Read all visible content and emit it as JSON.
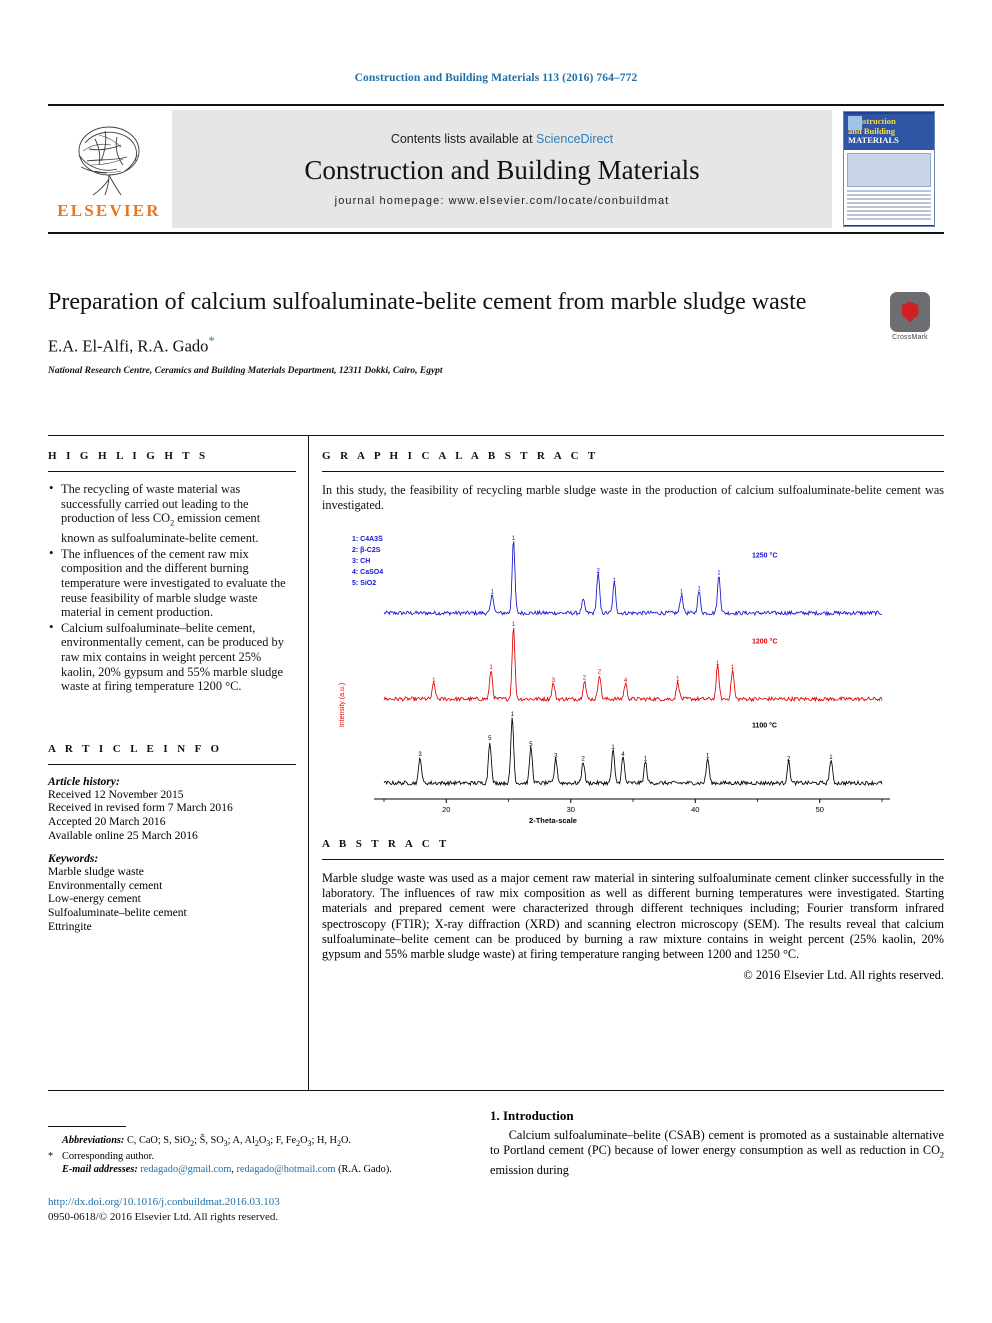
{
  "running_head": "Construction and Building Materials 113 (2016) 764–772",
  "masthead": {
    "contents_prefix": "Contents lists available at ",
    "sciencedirect": "ScienceDirect",
    "journal_title": "Construction and Building Materials",
    "homepage": "journal homepage: www.elsevier.com/locate/conbuildmat",
    "publisher": "ELSEVIER",
    "cover": {
      "line1": "Construction",
      "line2": "and Building",
      "line3": "MATERIALS"
    }
  },
  "article": {
    "title": "Preparation of calcium sulfoaluminate-belite cement from marble sludge waste",
    "authors": "E.A. El-Alfi, R.A. Gado",
    "corresponding_marker": "*",
    "affiliation": "National Research Centre, Ceramics and Building Materials Department, 12311 Dokki, Cairo, Egypt",
    "crossmark_label": "CrossMark"
  },
  "highlights": {
    "heading": "H I G H L I G H T S",
    "items": [
      "The recycling of waste material was successfully carried out leading to the production of less CO2 emission cement known as sulfoaluminate-belite cement.",
      "The influences of the cement raw mix composition and the different burning temperature were investigated to evaluate the reuse feasibility of marble sludge waste material in cement production.",
      "Calcium sulfoaluminate–belite cement, environmentally cement, can be produced by raw mix contains in weight percent 25% kaolin, 20% gypsum and 55% marble sludge waste at firing temperature 1200 °C."
    ]
  },
  "graphical_abstract": {
    "heading": "G R A P H I C A L   A B S T R A C T",
    "text": "In this study, the feasibility of recycling marble sludge waste in the production of calcium sulfoaluminate-belite cement was investigated."
  },
  "chart_data": {
    "type": "line",
    "title": "",
    "xlabel": "2-Theta-scale",
    "ylabel": "Intensity (a.u.)",
    "xlim": [
      15,
      55
    ],
    "xticks": [
      20,
      30,
      40,
      50
    ],
    "grid": false,
    "legend_position": "top-left",
    "legend": [
      "1: C4A3S̅",
      "2: β-C2S",
      "3: CH",
      "4: CaSO4",
      "5: SiO2"
    ],
    "series": [
      {
        "name": "1250 °C",
        "color": "#1414d2",
        "annotation": "1250 °C",
        "peaks": [
          {
            "x": 23.7,
            "h": 0.26,
            "label": "1"
          },
          {
            "x": 25.4,
            "h": 1.0,
            "label": "1"
          },
          {
            "x": 31.0,
            "h": 0.18,
            "label": ""
          },
          {
            "x": 32.2,
            "h": 0.55,
            "label": "2"
          },
          {
            "x": 33.5,
            "h": 0.42,
            "label": "1"
          },
          {
            "x": 38.9,
            "h": 0.26,
            "label": "1"
          },
          {
            "x": 40.3,
            "h": 0.3,
            "label": "1"
          },
          {
            "x": 41.9,
            "h": 0.52,
            "label": "1"
          }
        ]
      },
      {
        "name": "1200 °C",
        "color": "#e00000",
        "annotation": "1200 °C",
        "peaks": [
          {
            "x": 19.0,
            "h": 0.22,
            "label": "1"
          },
          {
            "x": 23.6,
            "h": 0.4,
            "label": "1"
          },
          {
            "x": 25.4,
            "h": 1.0,
            "label": "1"
          },
          {
            "x": 28.6,
            "h": 0.22,
            "label": "3"
          },
          {
            "x": 31.1,
            "h": 0.26,
            "label": "2"
          },
          {
            "x": 32.3,
            "h": 0.34,
            "label": "2"
          },
          {
            "x": 34.4,
            "h": 0.22,
            "label": "4"
          },
          {
            "x": 38.6,
            "h": 0.24,
            "label": "1"
          },
          {
            "x": 41.8,
            "h": 0.46,
            "label": "1"
          },
          {
            "x": 43.0,
            "h": 0.4,
            "label": "1"
          }
        ]
      },
      {
        "name": "1100 °C",
        "color": "#000000",
        "annotation": "1100 °C",
        "peaks": [
          {
            "x": 17.9,
            "h": 0.36,
            "label": "3"
          },
          {
            "x": 23.5,
            "h": 0.58,
            "label": "5"
          },
          {
            "x": 25.3,
            "h": 0.92,
            "label": "1"
          },
          {
            "x": 26.8,
            "h": 0.5,
            "label": "5"
          },
          {
            "x": 28.8,
            "h": 0.34,
            "label": "3"
          },
          {
            "x": 31.0,
            "h": 0.3,
            "label": "2"
          },
          {
            "x": 33.4,
            "h": 0.46,
            "label": "1"
          },
          {
            "x": 34.2,
            "h": 0.36,
            "label": "4"
          },
          {
            "x": 36.0,
            "h": 0.3,
            "label": "1"
          },
          {
            "x": 41.0,
            "h": 0.34,
            "label": "1"
          },
          {
            "x": 47.5,
            "h": 0.3,
            "label": "2"
          },
          {
            "x": 50.9,
            "h": 0.32,
            "label": "1"
          }
        ]
      }
    ]
  },
  "article_info": {
    "heading": "A R T I C L E   I N F O",
    "history_label": "Article history:",
    "history": [
      "Received 12 November 2015",
      "Received in revised form 7 March 2016",
      "Accepted 20 March 2016",
      "Available online 25 March 2016"
    ],
    "keywords_label": "Keywords:",
    "keywords": [
      "Marble sludge waste",
      "Environmentally cement",
      "Low-energy cement",
      "Sulfoaluminate–belite cement",
      "Ettringite"
    ]
  },
  "abstract": {
    "heading": "A B S T R A C T",
    "text": "Marble sludge waste was used as a major cement raw material in sintering sulfoaluminate cement clinker successfully in the laboratory. The influences of raw mix composition as well as different burning temperatures were investigated. Starting materials and prepared cement were characterized through different techniques including; Fourier transform infrared spectroscopy (FTIR); X-ray diffraction (XRD) and scanning electron microscopy (SEM). The results reveal that calcium sulfoaluminate–belite cement can be produced by burning a raw mixture contains in weight percent (25% kaolin, 20% gypsum and 55% marble sludge waste) at firing temperature ranging between 1200 and 1250 °C.",
    "copyright": "© 2016 Elsevier Ltd. All rights reserved."
  },
  "introduction": {
    "heading": "1. Introduction",
    "text": "Calcium sulfoaluminate–belite (CSAB) cement is promoted as a sustainable alternative to Portland cement (PC) because of lower energy consumption as well as reduction in CO2 emission during"
  },
  "footnotes": {
    "abbrev_label": "Abbreviations:",
    "abbrev_text": "C, CaO; S, SiO2; Š, SO3; A, Al2O3; F, Fe2O3; H, H2O.",
    "corresponding_mark": "*",
    "corresponding_text": "Corresponding author.",
    "email_label": "E-mail addresses:",
    "email1": "redagado@gmail.com",
    "email2": "redagado@hotmail.com",
    "email_suffix": "(R.A. Gado).",
    "doi": "http://dx.doi.org/10.1016/j.conbuildmat.2016.03.103",
    "issn": "0950-0618/© 2016 Elsevier Ltd. All rights reserved."
  }
}
